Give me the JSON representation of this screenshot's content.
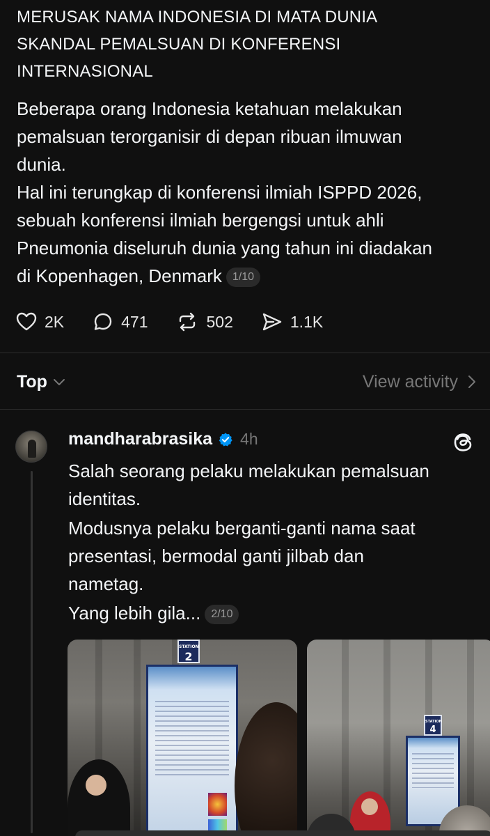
{
  "main_post": {
    "title_lines": [
      "MERUSAK NAMA INDONESIA DI MATA DUNIA",
      "SKANDAL PEMALSUAN DI KONFERENSI",
      "INTERNASIONAL"
    ],
    "body_lines": [
      "Beberapa orang Indonesia ketahuan melakukan",
      "pemalsuan terorganisir di depan ribuan ilmuwan",
      "dunia.",
      "Hal ini terungkap di konferensi ilmiah ISPPD 2026,",
      "sebuah konferensi ilmiah bergengsi untuk ahli",
      "Pneumonia diseluruh dunia yang tahun ini diadakan",
      "di Kopenhagen, Denmark"
    ],
    "counter": "1/10",
    "likes": "2K",
    "comments": "471",
    "reposts": "502",
    "shares": "1.1K"
  },
  "sort": {
    "label": "Top",
    "view_activity": "View activity"
  },
  "reply": {
    "username": "mandharabrasika",
    "time": "4h",
    "paragraphs": [
      [
        "Salah seorang pelaku melakukan pemalsuan",
        "identitas."
      ],
      [
        "Modusnya pelaku berganti-ganti nama saat",
        "presentasi, bermodal ganti jilbab dan",
        "nametag."
      ],
      [
        "Yang lebih gila..."
      ]
    ],
    "counter": "2/10",
    "media": [
      {
        "station_label": "STATION",
        "station_number": "2"
      },
      {
        "station_label": "STATION",
        "station_number": "4"
      }
    ]
  },
  "colors": {
    "background": "#101010",
    "text": "#f3f5f7",
    "muted": "#777777",
    "verified": "#0095f6"
  }
}
